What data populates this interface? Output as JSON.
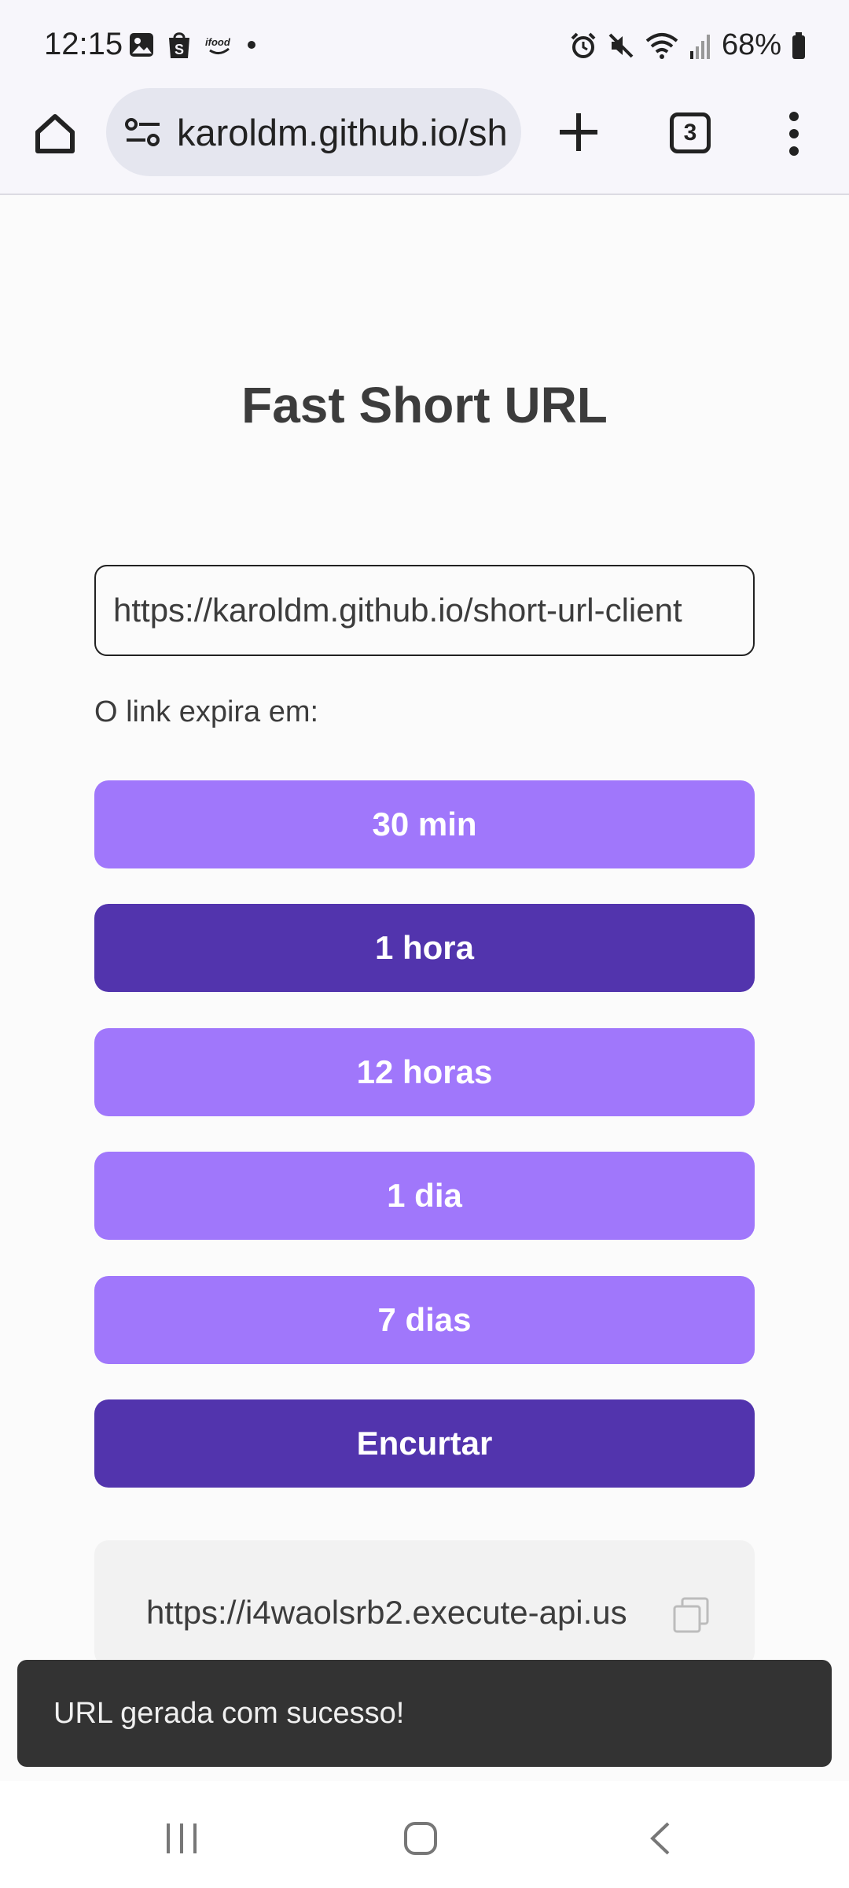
{
  "status_bar": {
    "time": "12:15",
    "battery": "68%",
    "notification_icons": [
      "gallery-icon",
      "shop-icon",
      "ifood-icon",
      "dot-icon"
    ],
    "system_icons": [
      "alarm-icon",
      "mute-icon",
      "wifi-icon",
      "signal-icon",
      "battery-icon"
    ]
  },
  "browser": {
    "url": "karoldm.github.io/sh",
    "tab_count": "3"
  },
  "page": {
    "title": "Fast Short URL",
    "url_input_value": "https://karoldm.github.io/short-url-client",
    "expire_label": "O link expira em:",
    "options": [
      {
        "label": "30 min",
        "selected": false
      },
      {
        "label": "1 hora",
        "selected": true
      },
      {
        "label": "12 horas",
        "selected": false
      },
      {
        "label": "1 dia",
        "selected": false
      },
      {
        "label": "7 dias",
        "selected": false
      }
    ],
    "submit_label": "Encurtar",
    "result_url": "https://i4waolsrb2.execute-api.us"
  },
  "snackbar": {
    "message": "URL gerada com sucesso!"
  },
  "colors": {
    "option_default": "#a077fb",
    "option_selected": "#5234ad",
    "submit": "#5234ad",
    "snackbar_bg": "#333333"
  }
}
